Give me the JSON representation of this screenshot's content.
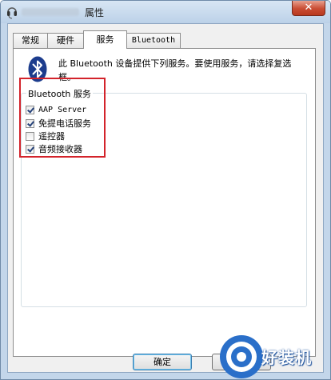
{
  "window": {
    "title": "属性",
    "close_glyph": "✕"
  },
  "tabs": [
    {
      "label": "常规"
    },
    {
      "label": "硬件"
    },
    {
      "label": "服务"
    },
    {
      "label": "Bluetooth"
    }
  ],
  "active_tab": "服务",
  "services_page": {
    "description": "此 Bluetooth 设备提供下列服务。要使用服务，请选择复选框。",
    "group_label": "Bluetooth 服务",
    "items": [
      {
        "label": "AAP Server",
        "checked": true
      },
      {
        "label": "免提电话服务",
        "checked": true
      },
      {
        "label": "遥控器",
        "checked": false
      },
      {
        "label": "音频接收器",
        "checked": true
      }
    ]
  },
  "buttons": {
    "ok": "确定",
    "cancel": "取"
  },
  "watermark": {
    "text": "好装机"
  },
  "colors": {
    "highlight": "#d3232b",
    "close_button": "#c94c33",
    "bluetooth_icon": "#1c3c8d",
    "watermark": "#2a6fc9"
  }
}
